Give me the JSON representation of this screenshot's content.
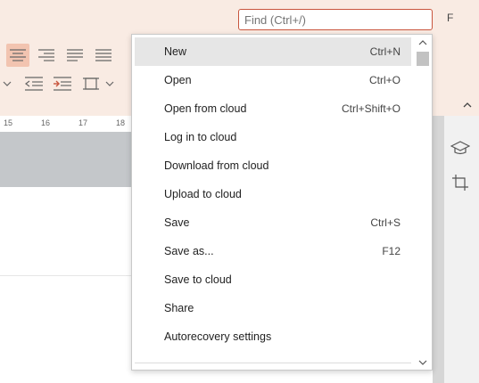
{
  "search": {
    "placeholder": "Find (Ctrl+/)"
  },
  "topbar": {
    "right_button": "F"
  },
  "ruler": {
    "ticks": [
      "15",
      "16",
      "17",
      "18"
    ]
  },
  "file_menu": {
    "items": [
      {
        "label": "New",
        "shortcut": "Ctrl+N",
        "highlighted": true
      },
      {
        "label": "Open",
        "shortcut": "Ctrl+O"
      },
      {
        "label": "Open from cloud",
        "shortcut": "Ctrl+Shift+O"
      },
      {
        "label": "Log in to cloud",
        "shortcut": ""
      },
      {
        "label": "Download from cloud",
        "shortcut": ""
      },
      {
        "label": "Upload to cloud",
        "shortcut": ""
      },
      {
        "label": "Save",
        "shortcut": "Ctrl+S"
      },
      {
        "label": "Save as...",
        "shortcut": "F12"
      },
      {
        "label": "Save to cloud",
        "shortcut": ""
      },
      {
        "label": "Share",
        "shortcut": ""
      },
      {
        "label": "Autorecovery settings",
        "shortcut": ""
      }
    ]
  },
  "icons": {
    "align": [
      "align-center-icon",
      "align-right-icon",
      "align-justify-icon",
      "align-distributed-icon"
    ],
    "indent": [
      "chevron-down-icon",
      "decrease-indent-icon",
      "increase-indent-icon",
      "page-margins-icon"
    ],
    "side_panel": [
      "graduation-cap-icon",
      "crop-icon"
    ]
  },
  "colors": {
    "accent": "#c8553d",
    "toolbar_bg": "#f9ebe3",
    "highlight": "#e6e6e6"
  }
}
